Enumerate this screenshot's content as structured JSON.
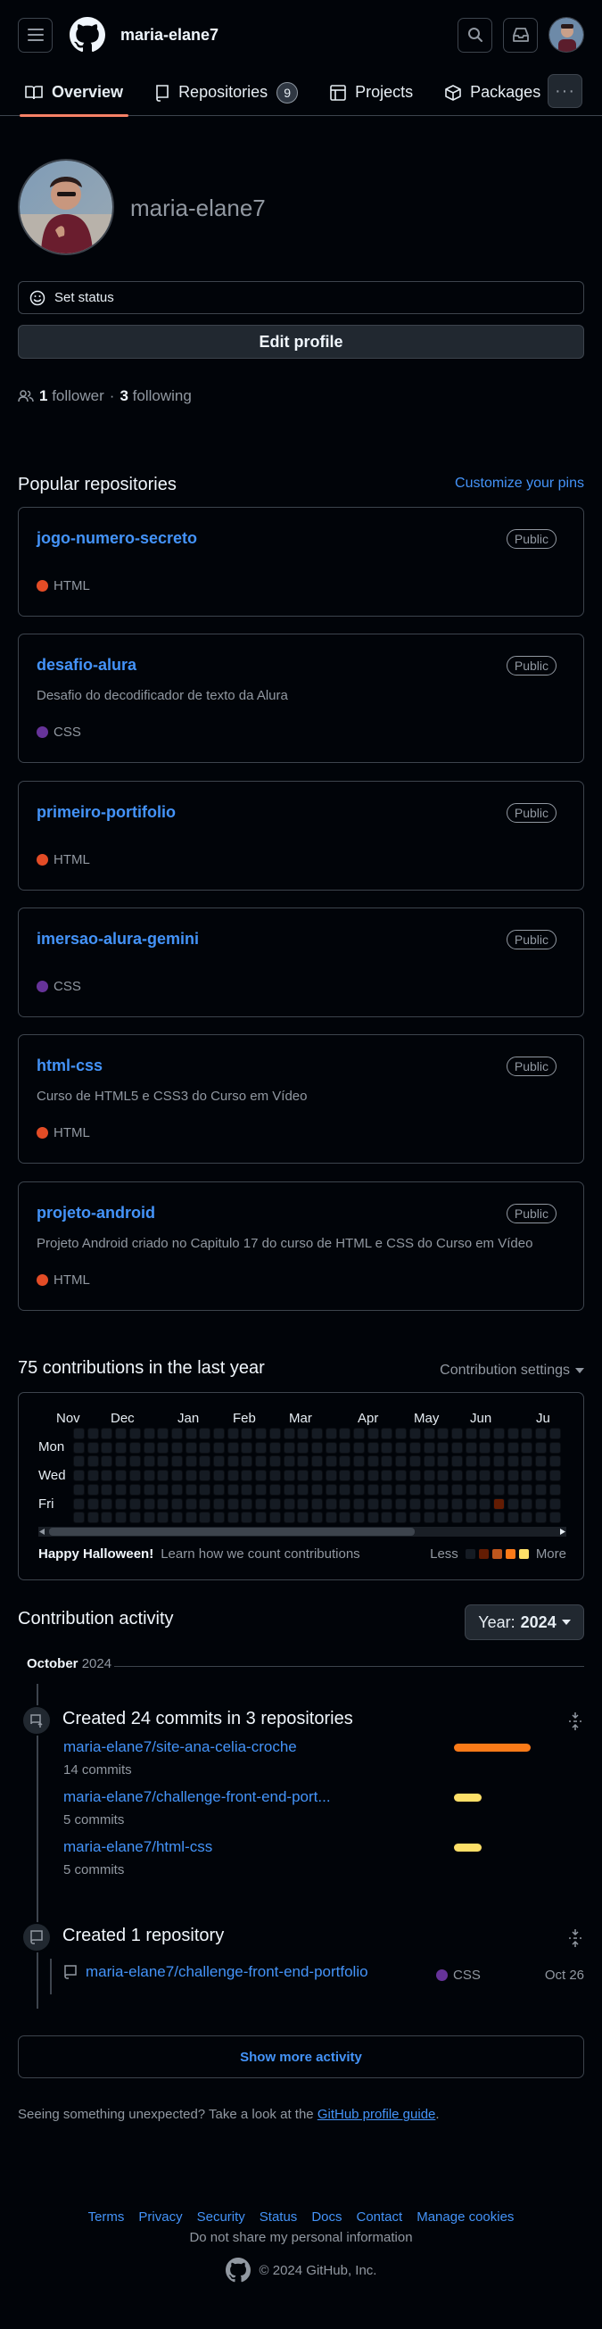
{
  "header": {
    "username": "maria-elane7",
    "menu_icon": "hamburger-icon",
    "logo_icon": "github-mark-icon",
    "search_icon": "search-icon",
    "inbox_icon": "inbox-icon"
  },
  "tabs": [
    {
      "label": "Overview",
      "icon": "book-icon",
      "active": true
    },
    {
      "label": "Repositories",
      "icon": "repo-icon",
      "count": "9"
    },
    {
      "label": "Projects",
      "icon": "table-icon"
    },
    {
      "label": "Packages",
      "icon": "package-icon"
    }
  ],
  "more_label": "···",
  "profile": {
    "name": "maria-elane7",
    "set_status": "Set status",
    "edit_profile": "Edit profile",
    "followers_count": "1",
    "followers_word": "follower",
    "separator": "·",
    "following_count": "3",
    "following_word": "following"
  },
  "popular": {
    "title": "Popular repositories",
    "customize": "Customize your pins",
    "repos": [
      {
        "name": "jogo-numero-secreto",
        "visibility": "Public",
        "description": "",
        "language": "HTML",
        "lang_color": "#e34c26"
      },
      {
        "name": "desafio-alura",
        "visibility": "Public",
        "description": "Desafio do decodificador de texto da Alura",
        "language": "CSS",
        "lang_color": "#663399"
      },
      {
        "name": "primeiro-portifolio",
        "visibility": "Public",
        "description": "",
        "language": "HTML",
        "lang_color": "#e34c26"
      },
      {
        "name": "imersao-alura-gemini",
        "visibility": "Public",
        "description": "",
        "language": "CSS",
        "lang_color": "#663399"
      },
      {
        "name": "html-css",
        "visibility": "Public",
        "description": "Curso de HTML5 e CSS3 do Curso em Vídeo",
        "language": "HTML",
        "lang_color": "#e34c26"
      },
      {
        "name": "projeto-android",
        "visibility": "Public",
        "description": "Projeto Android criado no Capitulo 17 do curso de HTML e CSS do Curso em Vídeo",
        "language": "HTML",
        "lang_color": "#e34c26"
      }
    ]
  },
  "contributions": {
    "title": "75 contributions in the last year",
    "settings": "Contribution settings",
    "months": [
      "Nov",
      "Dec",
      "Jan",
      "Feb",
      "Mar",
      "Apr",
      "May",
      "Jun",
      "Ju"
    ],
    "days": [
      "Mon",
      "Wed",
      "Fri"
    ],
    "footer_bold": "Happy Halloween!",
    "footer_link": "Learn how we count contributions",
    "less": "Less",
    "more": "More",
    "legend_colors": [
      "#151b23",
      "#631c03",
      "#bd561d",
      "#fa7a18",
      "#fddf68"
    ],
    "empty_color": "#151b23",
    "active_color": "#631c03"
  },
  "activity": {
    "title": "Contribution activity",
    "year_prefix": "Year:",
    "year": "2024",
    "month": "October",
    "month_year": "2024",
    "commits_title": "Created 24 commits in 3 repositories",
    "commit_repos": [
      {
        "name": "maria-elane7/site-ana-celia-croche",
        "commits": "14 commits",
        "share": 1.0,
        "color": "#fa7a18"
      },
      {
        "name": "maria-elane7/challenge-front-end-port...",
        "commits": "5 commits",
        "share": 0.36,
        "color": "#fddf68"
      },
      {
        "name": "maria-elane7/html-css",
        "commits": "5 commits",
        "share": 0.36,
        "color": "#fddf68"
      }
    ],
    "repo_title": "Created 1 repository",
    "created_repo": {
      "name": "maria-elane7/challenge-front-end-portfolio",
      "language": "CSS",
      "lang_color": "#663399",
      "date": "Oct 26"
    },
    "show_more": "Show more activity",
    "unexpected_text": "Seeing something unexpected? Take a look at the",
    "unexpected_link": "GitHub profile guide",
    "unexpected_end": "."
  },
  "footer": {
    "links": [
      "Terms",
      "Privacy",
      "Security",
      "Status",
      "Docs",
      "Contact",
      "Manage cookies"
    ],
    "do_not_share": "Do not share my personal information",
    "copyright": "© 2024 GitHub, Inc."
  }
}
